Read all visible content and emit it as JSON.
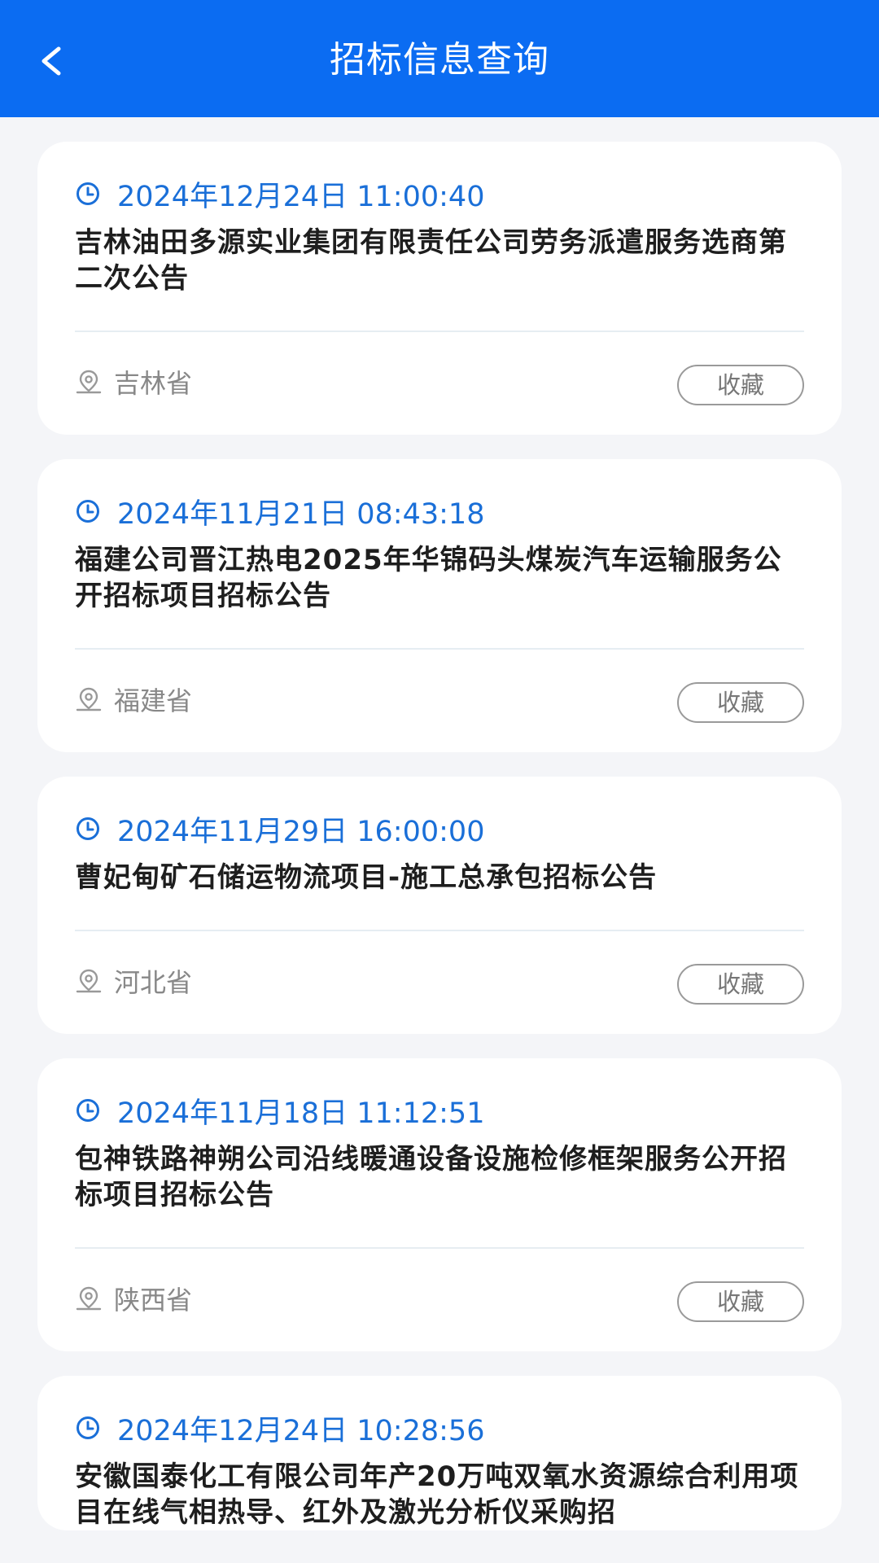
{
  "header": {
    "title": "招标信息查询"
  },
  "items": [
    {
      "time": "2024年12月24日 11:00:40",
      "title": "吉林油田多源实业集团有限责任公司劳务派遣服务选商第二次公告",
      "location": "吉林省",
      "fav_label": "收藏"
    },
    {
      "time": "2024年11月21日 08:43:18",
      "title": "福建公司晋江热电2025年华锦码头煤炭汽车运输服务公开招标项目招标公告",
      "location": "福建省",
      "fav_label": "收藏"
    },
    {
      "time": "2024年11月29日 16:00:00",
      "title": "曹妃甸矿石储运物流项目-施工总承包招标公告",
      "location": "河北省",
      "fav_label": "收藏"
    },
    {
      "time": "2024年11月18日 11:12:51",
      "title": "包神铁路神朔公司沿线暖通设备设施检修框架服务公开招标项目招标公告",
      "location": "陕西省",
      "fav_label": "收藏"
    },
    {
      "time": "2024年12月24日 10:28:56",
      "title": "安徽国泰化工有限公司年产20万吨双氧水资源综合利用项目在线气相热导、红外及激光分析仪采购招",
      "location": "",
      "fav_label": ""
    }
  ],
  "colors": {
    "header_bg": "#0b6cf2",
    "time_text": "#1a6fd8",
    "page_bg": "#f4f5f8"
  }
}
